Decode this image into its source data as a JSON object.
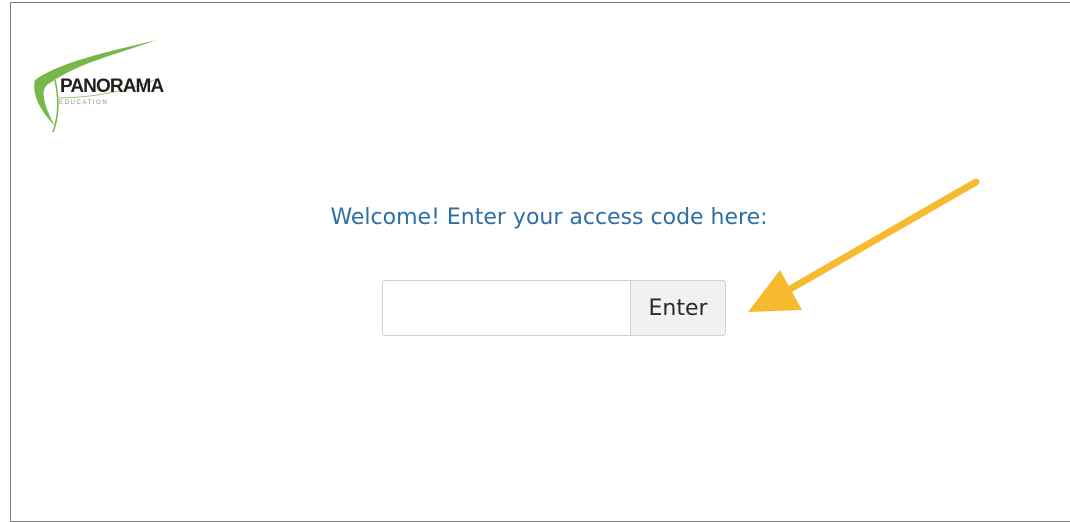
{
  "logo": {
    "word": "PANORAMA",
    "subtitle": "EDUCATION",
    "swoosh_color": "#6fb345"
  },
  "prompt": {
    "text": "Welcome! Enter your access code here:"
  },
  "access_form": {
    "input_value": "",
    "input_placeholder": "",
    "button_label": "Enter"
  },
  "annotation": {
    "icon": "arrow-icon",
    "color": "#f7b92e"
  }
}
